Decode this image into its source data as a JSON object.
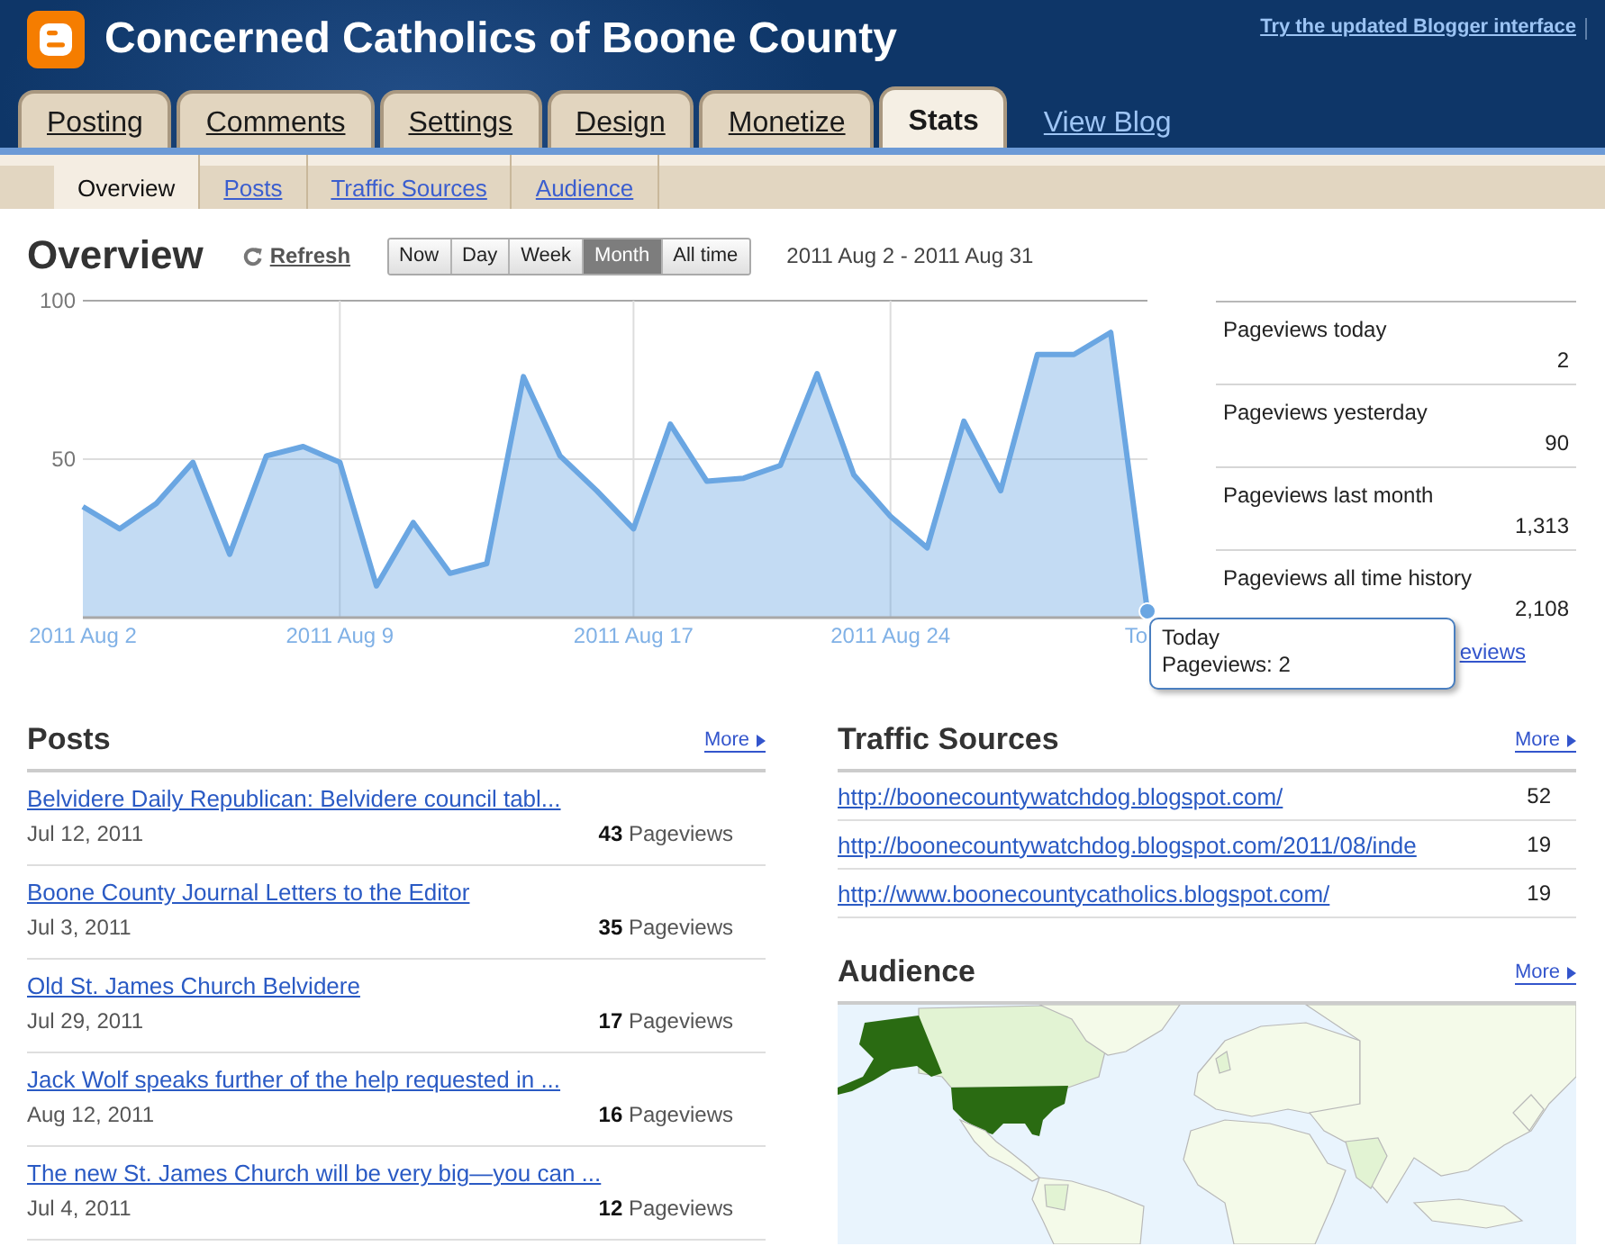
{
  "header": {
    "title": "Concerned Catholics of Boone County",
    "top_link": "Try the updated Blogger interface"
  },
  "tabs": [
    {
      "label": "Posting",
      "selected": false
    },
    {
      "label": "Comments",
      "selected": false
    },
    {
      "label": "Settings",
      "selected": false
    },
    {
      "label": "Design",
      "selected": false
    },
    {
      "label": "Monetize",
      "selected": false
    },
    {
      "label": "Stats",
      "selected": true
    }
  ],
  "view_blog": "View Blog",
  "subtabs": [
    {
      "label": "Overview",
      "selected": true
    },
    {
      "label": "Posts",
      "selected": false
    },
    {
      "label": "Traffic Sources",
      "selected": false
    },
    {
      "label": "Audience",
      "selected": false
    }
  ],
  "overview": {
    "heading": "Overview",
    "refresh": "Refresh",
    "ranges": [
      {
        "label": "Now",
        "selected": false
      },
      {
        "label": "Day",
        "selected": false
      },
      {
        "label": "Week",
        "selected": false
      },
      {
        "label": "Month",
        "selected": true
      },
      {
        "label": "All time",
        "selected": false
      }
    ],
    "date_range": "2011 Aug 2 - 2011 Aug 31",
    "chart_data": {
      "type": "area",
      "categories": [
        "2011 Aug 2",
        null,
        null,
        null,
        null,
        null,
        null,
        "2011 Aug 9",
        null,
        null,
        null,
        null,
        null,
        null,
        null,
        "2011 Aug 17",
        null,
        null,
        null,
        null,
        null,
        null,
        "2011 Aug 24",
        null,
        null,
        null,
        null,
        null,
        null,
        "To"
      ],
      "series": [
        {
          "color": "#6aa6e2",
          "values": [
            35,
            28,
            36,
            49,
            20,
            51,
            54,
            49,
            10,
            30,
            14,
            17,
            76,
            51,
            40,
            28,
            61,
            43,
            44,
            48,
            77,
            45,
            32,
            22,
            62,
            40,
            83,
            83,
            90,
            2
          ]
        }
      ],
      "ylim": [
        0,
        100
      ],
      "yticks": [
        50,
        100
      ],
      "grid": true
    },
    "tooltip": {
      "title": "Today",
      "text": "Pageviews: 2"
    },
    "stats": [
      {
        "label": "Pageviews today",
        "value": "2"
      },
      {
        "label": "Pageviews yesterday",
        "value": "90"
      },
      {
        "label": "Pageviews last month",
        "value": "1,313"
      },
      {
        "label": "Pageviews all time history",
        "value": "2,108"
      }
    ],
    "stats_link": "eviews"
  },
  "posts": {
    "heading": "Posts",
    "more": "More",
    "items": [
      {
        "title": "Belvidere Daily Republican: Belvidere council tabl...",
        "date": "Jul 12, 2011",
        "views": "**43** Pageviews"
      },
      {
        "title": "Boone County Journal Letters to the Editor",
        "date": "Jul 3, 2011",
        "views": "**35** Pageviews"
      },
      {
        "title": "Old St. James Church Belvidere",
        "date": "Jul 29, 2011",
        "views": "**17** Pageviews"
      },
      {
        "title": "Jack Wolf speaks further of the help requested in ...",
        "date": "Aug 12, 2011",
        "views": "**16** Pageviews"
      },
      {
        "title": "The new St. James Church will be very big—you can ...",
        "date": "Jul 4, 2011",
        "views": "**12** Pageviews"
      }
    ]
  },
  "traffic_sources": {
    "heading": "Traffic Sources",
    "more": "More",
    "items": [
      {
        "url": "http://boonecountywatchdog.blogspot.com/",
        "count": "52"
      },
      {
        "url": "http://boonecountywatchdog.blogspot.com/2011/08/inde",
        "count": "19"
      },
      {
        "url": "http://www.boonecountycatholics.blogspot.com/",
        "count": "19"
      }
    ]
  },
  "audience": {
    "heading": "Audience",
    "more": "More"
  }
}
